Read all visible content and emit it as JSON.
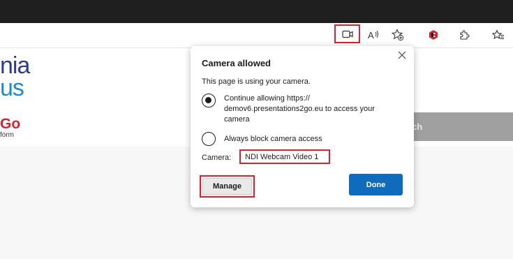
{
  "toolbar": {
    "camera_icon": "camera-icon",
    "read_aloud_icon": "read-aloud-icon",
    "favorite_add_icon": "favorite-add-icon",
    "extension_icon": "extension-red-icon",
    "extensions_icon": "puzzle-icon",
    "favorites_icon": "favorites-icon"
  },
  "page": {
    "logo_line1": "nia",
    "logo_line2": "us",
    "logo_brand": "Go",
    "logo_tagline": "form",
    "search_label": "rch"
  },
  "popup": {
    "title": "Camera allowed",
    "message": "This page is using your camera.",
    "option_allow": "Continue allowing https:// demov6.presentations2go.eu to access your camera",
    "option_block": "Always block camera access",
    "camera_label": "Camera:",
    "camera_value": "NDI Webcam Video 1",
    "manage_label": "Manage",
    "done_label": "Done"
  },
  "colors": {
    "accent": "#0f6cbd",
    "highlight": "#d6232f"
  }
}
